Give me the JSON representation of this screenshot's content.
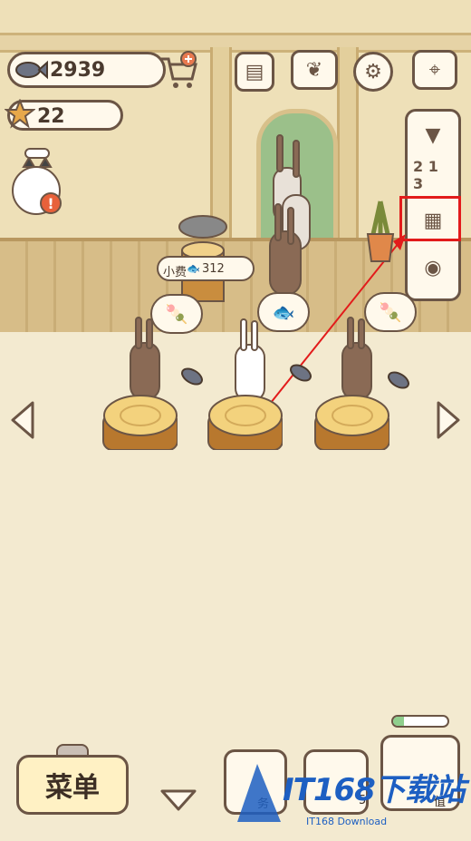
{
  "currency": {
    "fish": "2939",
    "stars": "22"
  },
  "tip": {
    "label": "小费",
    "amount": "312"
  },
  "menu": {
    "label": "菜单"
  },
  "bottom": {
    "card1_text": "务",
    "card2_text": "5",
    "card3_text": "值"
  },
  "watermark": {
    "brand": "IT168下载站",
    "sub": "IT168 Download"
  },
  "progress": {
    "fill_fraction": 0.2
  },
  "colors": {
    "accent_red": "#e21b1b",
    "outline": "#6b5545",
    "cream": "#fff9ec"
  },
  "icons": {
    "top": [
      "newspaper-icon",
      "recipe-book-icon",
      "settings-gear-icon",
      "map-icon"
    ],
    "side": [
      "collapse-icon",
      "ranking-icon",
      "calendar-icon",
      "camera-icon"
    ]
  }
}
